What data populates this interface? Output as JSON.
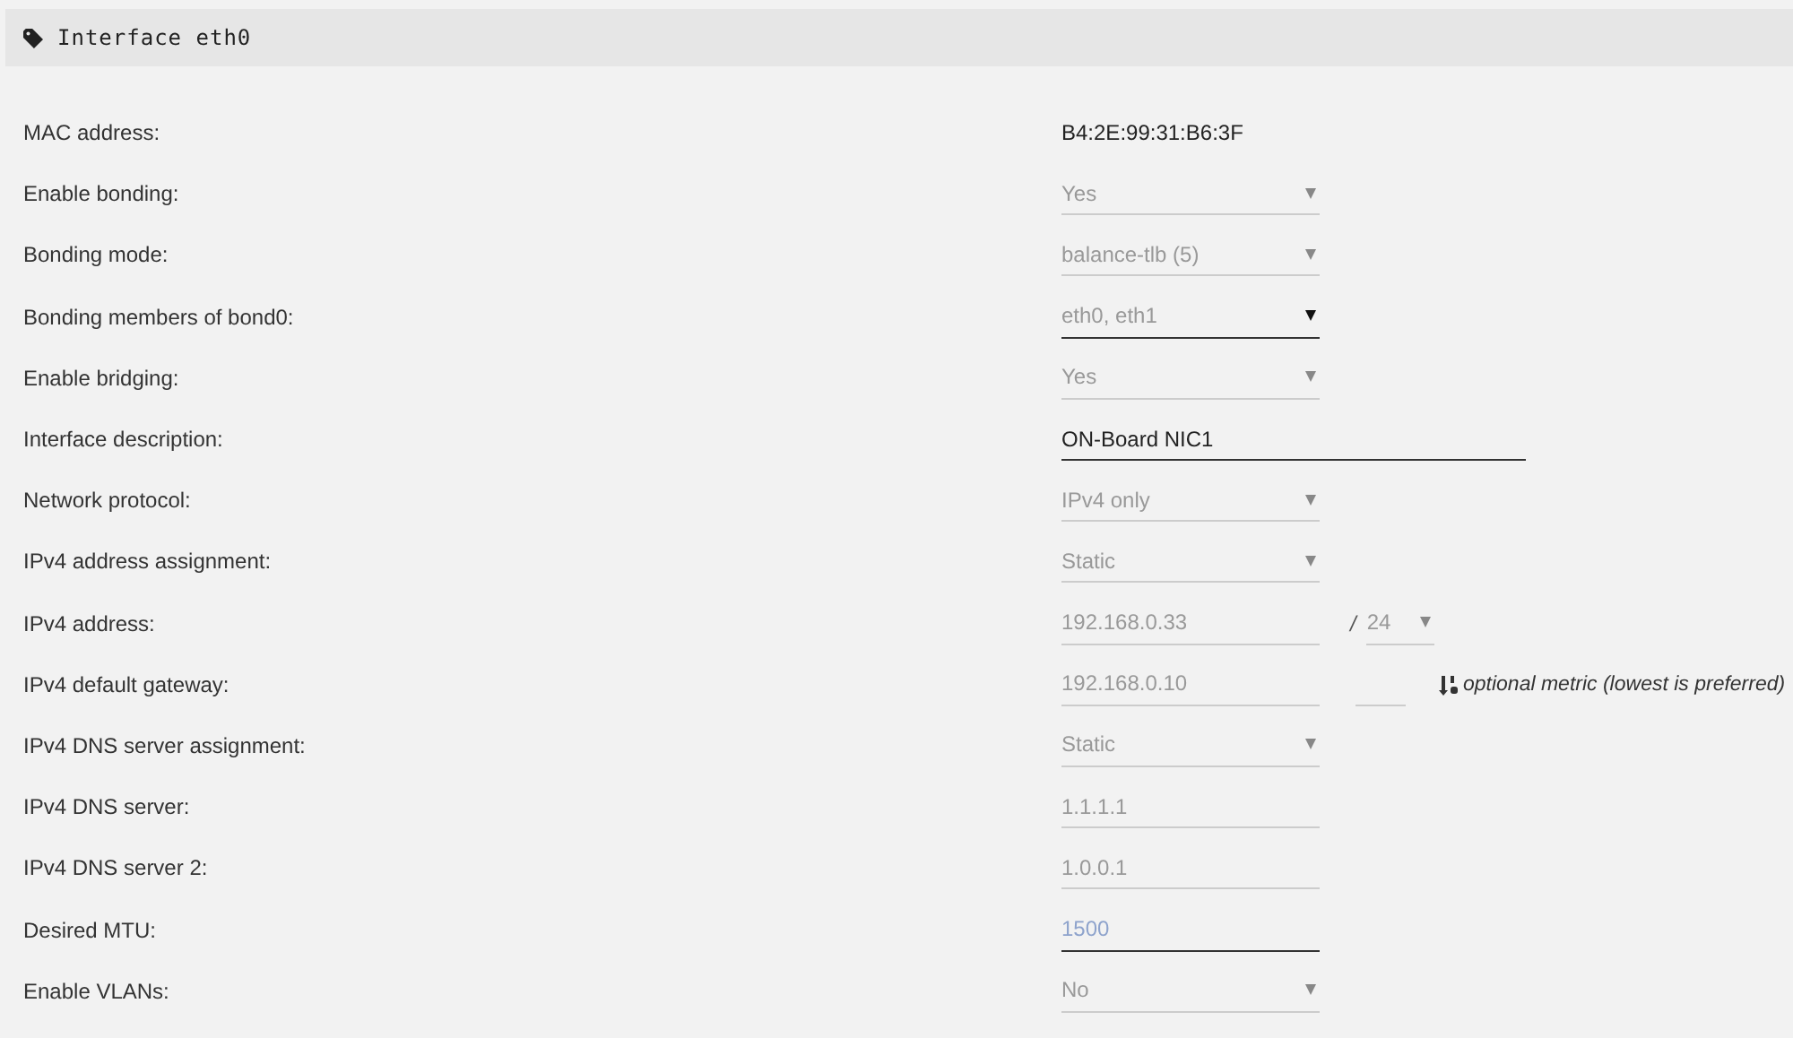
{
  "panel": {
    "title": "Interface eth0"
  },
  "rows": [
    {
      "label": "MAC address:",
      "kind": "text",
      "value": "B4:2E:99:31:B6:3F"
    },
    {
      "label": "Enable bonding:",
      "kind": "select",
      "value": "Yes",
      "disabled": true
    },
    {
      "label": "Bonding mode:",
      "kind": "select",
      "value": "balance-tlb (5)",
      "disabled": true
    },
    {
      "label": "Bonding members of bond0:",
      "kind": "select",
      "value": "eth0, eth1",
      "disabled": false
    },
    {
      "label": "Enable bridging:",
      "kind": "select",
      "value": "Yes",
      "disabled": true
    },
    {
      "label": "Interface description:",
      "kind": "input",
      "value": "ON-Board NIC1",
      "disabled": false,
      "wide": true
    },
    {
      "label": "Network protocol:",
      "kind": "select",
      "value": "IPv4 only",
      "disabled": true
    },
    {
      "label": "IPv4 address assignment:",
      "kind": "select",
      "value": "Static",
      "disabled": true
    },
    {
      "label": "IPv4 address:",
      "kind": "input",
      "value": "192.168.0.33",
      "disabled": true,
      "prefix": {
        "separator": "/",
        "value": "24"
      }
    },
    {
      "label": "IPv4 default gateway:",
      "kind": "input",
      "value": "192.168.0.10",
      "disabled": true,
      "metric": {
        "hint": "optional metric (lowest is preferred)"
      }
    },
    {
      "label": "IPv4 DNS server assignment:",
      "kind": "select",
      "value": "Static",
      "disabled": true
    },
    {
      "label": "IPv4 DNS server:",
      "kind": "input",
      "value": "1.1.1.1",
      "disabled": true
    },
    {
      "label": "IPv4 DNS server 2:",
      "kind": "input",
      "value": "1.0.0.1",
      "disabled": true
    },
    {
      "label": "Desired MTU:",
      "kind": "input",
      "placeholder": "1500",
      "disabled": false
    },
    {
      "label": "Enable VLANs:",
      "kind": "select",
      "value": "No",
      "disabled": true
    }
  ]
}
